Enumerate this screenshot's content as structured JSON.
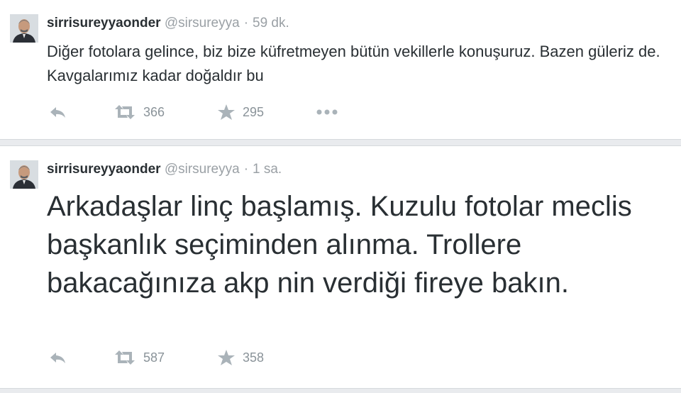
{
  "colors": {
    "text": "#292f33",
    "muted": "#9aa0a5",
    "icon": "#aab3b9"
  },
  "tweets": [
    {
      "display_name": "sirrisureyyaonder",
      "handle": "@sirsureyya",
      "separator": "·",
      "time": "59 dk.",
      "text": "Diğer fotolara gelince, biz bize küfretmeyen bütün vekillerle konuşuruz. Bazen güleriz de. Kavgalarımız kadar doğaldır bu",
      "retweets": "366",
      "favorites": "295"
    },
    {
      "display_name": "sirrisureyyaonder",
      "handle": "@sirsureyya",
      "separator": "·",
      "time": "1 sa.",
      "text": "Arkadaşlar linç başlamış. Kuzulu fotolar meclis başkanlık seçiminden alınma. Trollere bakacağınıza akp nin verdiği fireye bakın.",
      "retweets": "587",
      "favorites": "358"
    }
  ],
  "icons": [
    "reply-icon",
    "retweet-icon",
    "favorite-star-icon",
    "more-dots-icon"
  ]
}
